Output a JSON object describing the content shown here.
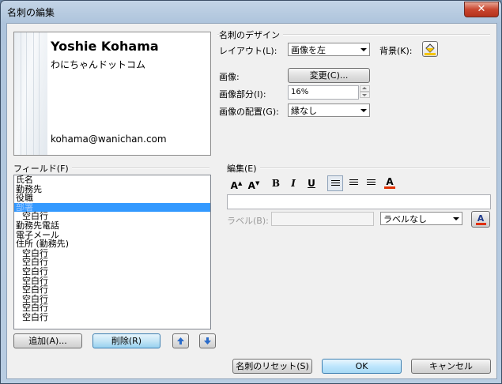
{
  "window": {
    "title": "名刺の編集",
    "close": "✕"
  },
  "card_preview": {
    "name": "Yoshie Kohama",
    "company": "わにちゃんドットコム",
    "email": "kohama@wanichan.com"
  },
  "design": {
    "group_label": "名刺のデザイン",
    "layout_label": "レイアウト(L):",
    "layout_value": "画像を左",
    "background_label": "背景(K):",
    "image_label": "画像:",
    "change_button": "変更(C)...",
    "image_area_label": "画像部分(I):",
    "image_area_value": "16%",
    "image_align_label": "画像の配置(G):",
    "image_align_value": "縁なし"
  },
  "fields": {
    "group_label": "フィールド(F)",
    "items": [
      {
        "label": "氏名",
        "indent": false,
        "selected": false
      },
      {
        "label": "勤務先",
        "indent": false,
        "selected": false
      },
      {
        "label": "役職",
        "indent": false,
        "selected": false
      },
      {
        "label": "部署",
        "indent": false,
        "selected": true
      },
      {
        "label": "空白行",
        "indent": true,
        "selected": false
      },
      {
        "label": "勤務先電話",
        "indent": false,
        "selected": false
      },
      {
        "label": "電子メール",
        "indent": false,
        "selected": false
      },
      {
        "label": "住所 (勤務先)",
        "indent": false,
        "selected": false
      },
      {
        "label": "空白行",
        "indent": true,
        "selected": false
      },
      {
        "label": "空白行",
        "indent": true,
        "selected": false
      },
      {
        "label": "空白行",
        "indent": true,
        "selected": false
      },
      {
        "label": "空白行",
        "indent": true,
        "selected": false
      },
      {
        "label": "空白行",
        "indent": true,
        "selected": false
      },
      {
        "label": "空白行",
        "indent": true,
        "selected": false
      },
      {
        "label": "空白行",
        "indent": true,
        "selected": false
      },
      {
        "label": "空白行",
        "indent": true,
        "selected": false
      }
    ],
    "add_button": "追加(A)...",
    "delete_button": "削除(R)"
  },
  "edit": {
    "group_label": "編集(E)",
    "grow_font": "A",
    "shrink_font": "A",
    "bold": "B",
    "italic": "I",
    "underline": "U",
    "font_color": "A",
    "field_value": "",
    "label_label": "ラベル(B):",
    "label_value": "",
    "label_position": "ラベルなし"
  },
  "footer": {
    "reset_button": "名刺のリセット(S)",
    "ok_button": "OK",
    "cancel_button": "キャンセル"
  },
  "colors": {
    "selection": "#3399ff",
    "font_color_bar": "#e03000",
    "titlebar": "#aec4dc"
  }
}
